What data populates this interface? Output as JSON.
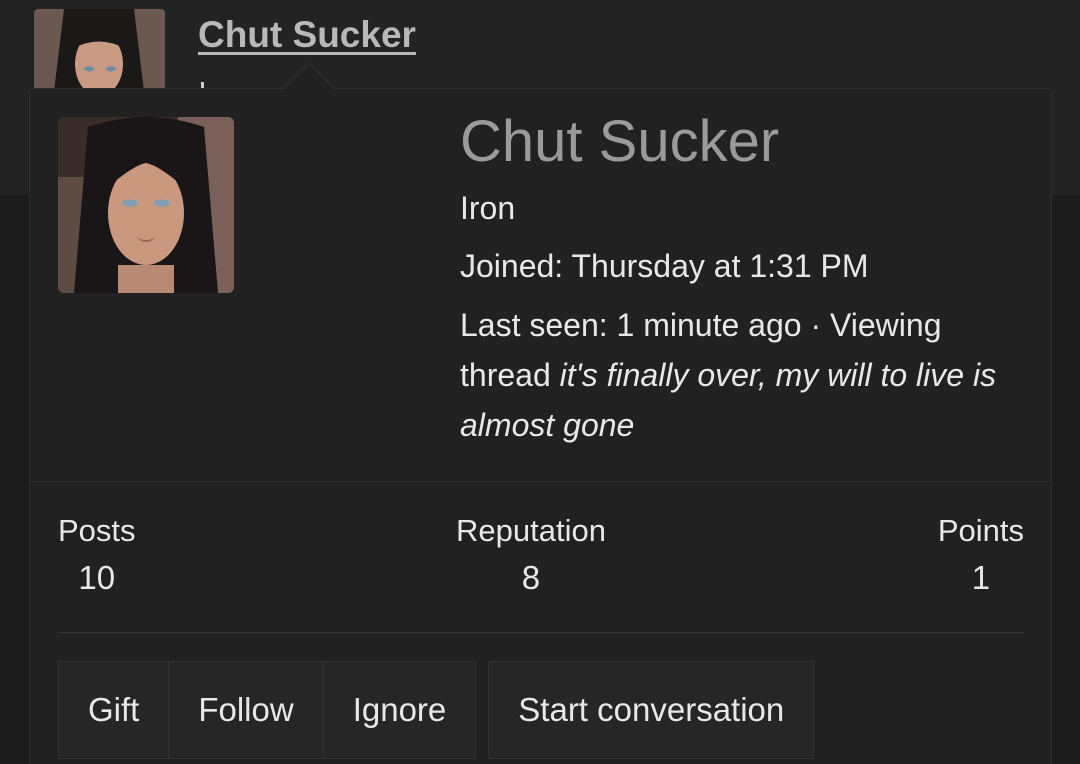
{
  "background": {
    "username": "Chut Sucker",
    "avatar_alt": "user-avatar"
  },
  "card": {
    "name": "Chut Sucker",
    "rank": "Iron",
    "joined": "Joined: Thursday at 1:31 PM",
    "last_seen_prefix": "Last seen: 1 minute ago · Viewing thread ",
    "last_seen_thread": "it's finally over, my will to live is almost gone"
  },
  "stats": {
    "posts_label": "Posts",
    "posts_value": "10",
    "reputation_label": "Reputation",
    "reputation_value": "8",
    "points_label": "Points",
    "points_value": "1"
  },
  "actions": {
    "gift": "Gift",
    "follow": "Follow",
    "ignore": "Ignore",
    "start_conversation": "Start conversation"
  },
  "colors": {
    "background": "#1e1e1e",
    "popup": "#212121",
    "name": "#9a9a9a",
    "text": "#e8e8e8"
  }
}
